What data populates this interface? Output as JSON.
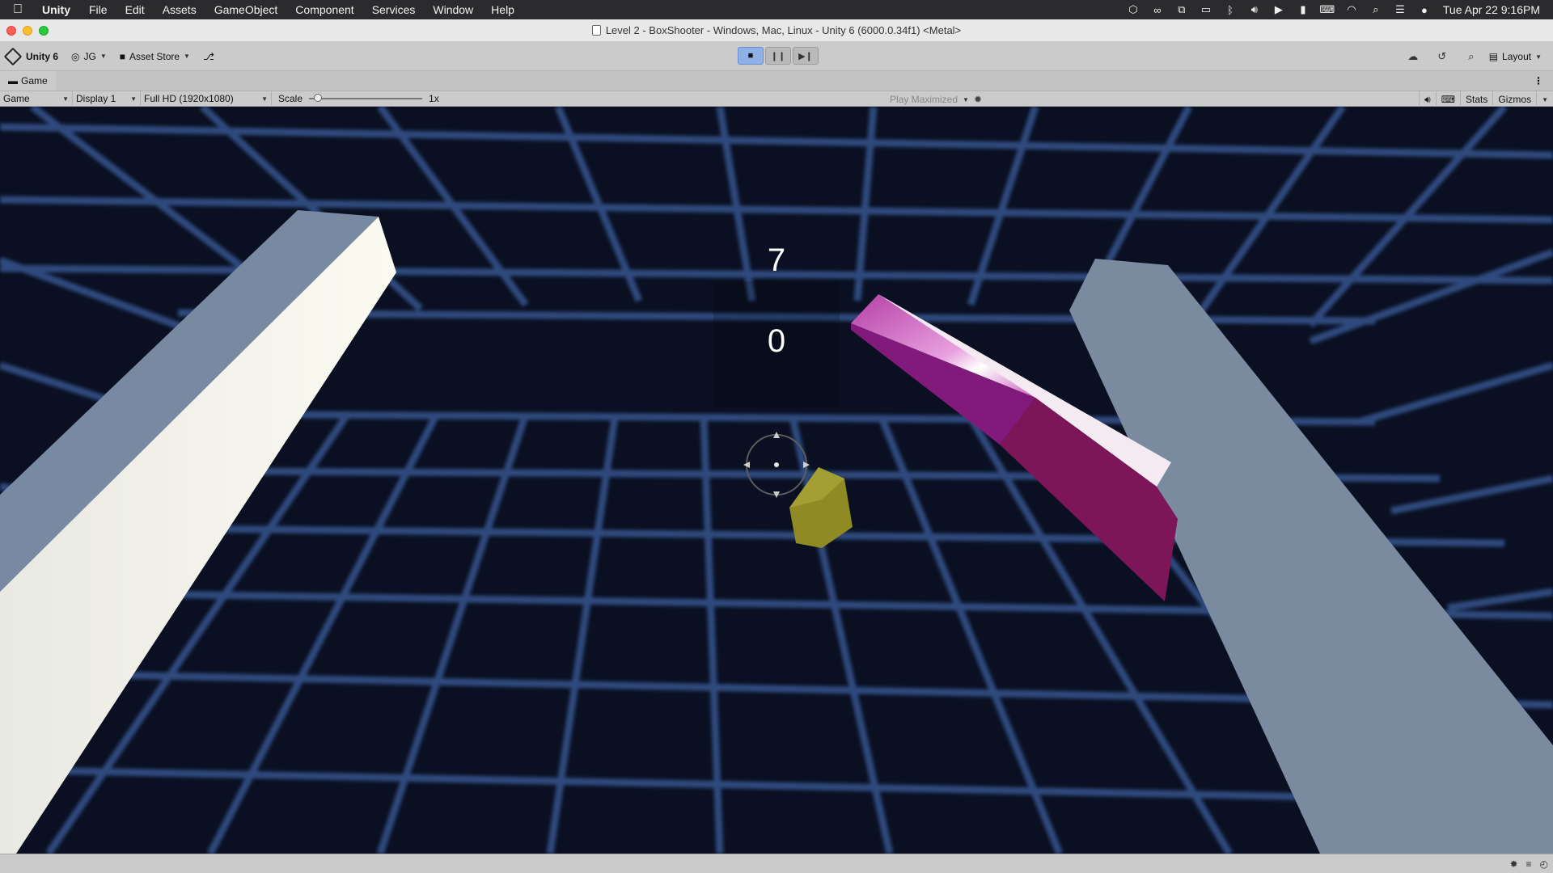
{
  "menubar": {
    "app": "Unity",
    "items": [
      "File",
      "Edit",
      "Assets",
      "GameObject",
      "Component",
      "Services",
      "Window",
      "Help"
    ],
    "clock": "Tue Apr 22  9:16PM"
  },
  "window": {
    "title": "Level 2 - BoxShooter - Windows, Mac, Linux - Unity 6 (6000.0.34f1) <Metal>"
  },
  "toolbar": {
    "unity_version": "Unity 6",
    "account": "JG",
    "asset_store": "Asset Store",
    "layout": "Layout"
  },
  "tab": {
    "label": "Game"
  },
  "gamebar": {
    "view_mode": "Game",
    "display": "Display 1",
    "resolution": "Full HD (1920x1080)",
    "scale_label": "Scale",
    "scale_value": "1x",
    "play_mode": "Play Maximized",
    "stats": "Stats",
    "gizmos": "Gizmos"
  },
  "hud": {
    "timer": "7",
    "score": "0"
  },
  "colors": {
    "background": "#0a1022",
    "grid": "#2d4a7d",
    "pillar": "#77869c",
    "pillar_lit": "#f2f2ea",
    "magenta_box": "#a01a8c",
    "yellow_box": "#8e8a22",
    "play_active": "#8fb0e6"
  }
}
